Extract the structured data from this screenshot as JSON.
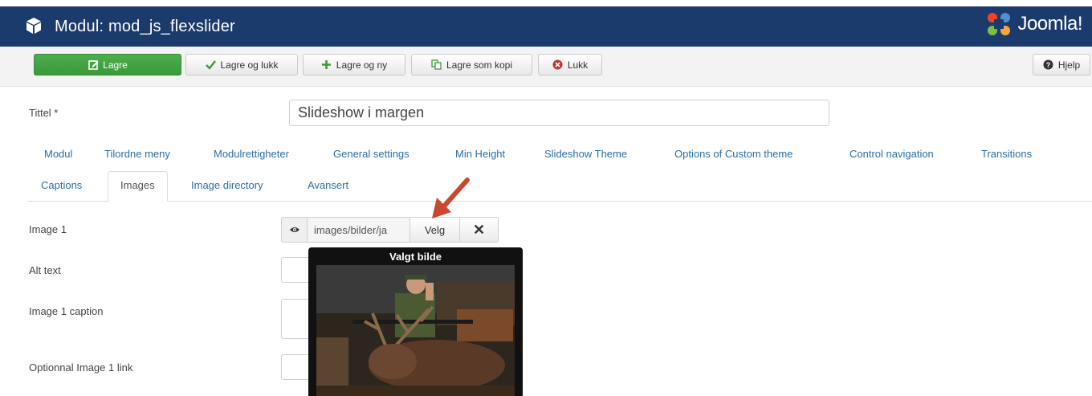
{
  "header": {
    "title": "Modul: mod_js_flexslider",
    "logo_text": "Joomla!",
    "colors": {
      "bar": "#1b3b6c"
    }
  },
  "toolbar": {
    "save": "Lagre",
    "save_close": "Lagre og lukk",
    "save_new": "Lagre og ny",
    "save_copy": "Lagre som kopi",
    "close": "Lukk",
    "help": "Hjelp"
  },
  "form": {
    "title_label": "Tittel *",
    "title_value": "Slideshow i margen"
  },
  "tabs": {
    "row1": [
      "Modul",
      "Tilordne meny",
      "Modulrettigheter",
      "General settings",
      "Min Height",
      "Slideshow Theme",
      "Options of Custom theme",
      "Control navigation",
      "Transitions"
    ],
    "row2": [
      "Captions",
      "Images",
      "Image directory",
      "Avansert"
    ],
    "active": "Images"
  },
  "fields": {
    "image1_label": "Image 1",
    "image1_path": "images/bilder/ja",
    "image1_select": "Velg",
    "image1_clear": "✕",
    "alt_label": "Alt text",
    "caption_label": "Image 1 caption",
    "link_label": "Optionnal Image 1 link"
  },
  "preview": {
    "title": "Valgt bilde"
  },
  "icons": [
    "cube-icon",
    "joomla-logo-icon",
    "edit-icon",
    "check-icon",
    "plus-icon",
    "copy-icon",
    "close-circle-icon",
    "help-circle-icon",
    "eye-icon",
    "arrow-annotation"
  ]
}
